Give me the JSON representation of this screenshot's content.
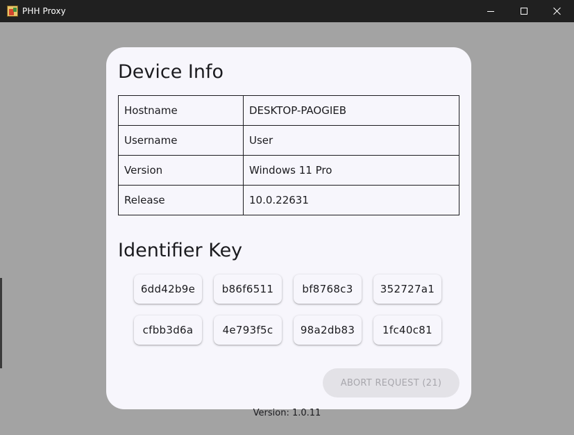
{
  "window": {
    "title": "PHH Proxy"
  },
  "device_info": {
    "title": "Device Info",
    "rows": [
      {
        "label": "Hostname",
        "value": "DESKTOP-PAOGIEB"
      },
      {
        "label": "Username",
        "value": "User"
      },
      {
        "label": "Version",
        "value": "Windows 11 Pro"
      },
      {
        "label": "Release",
        "value": "10.0.22631"
      }
    ]
  },
  "identifier": {
    "title": "Identifier Key",
    "keys": [
      "6dd42b9e",
      "b86f6511",
      "bf8768c3",
      "352727a1",
      "cfbb3d6a",
      "4e793f5c",
      "98a2db83",
      "1fc40c81"
    ]
  },
  "actions": {
    "abort_label": "ABORT REQUEST (21)"
  },
  "footer": {
    "version": "Version: 1.0.11"
  },
  "icons": {
    "app": "app-icon",
    "minimize": "minimize-icon",
    "maximize": "maximize-icon",
    "close": "close-icon"
  },
  "colors": {
    "titlebar": "#202020",
    "background": "#a3a3a3",
    "card": "#f7f6fc",
    "disabled_button": "#e3e2e7",
    "disabled_text": "#a8a7ad"
  }
}
